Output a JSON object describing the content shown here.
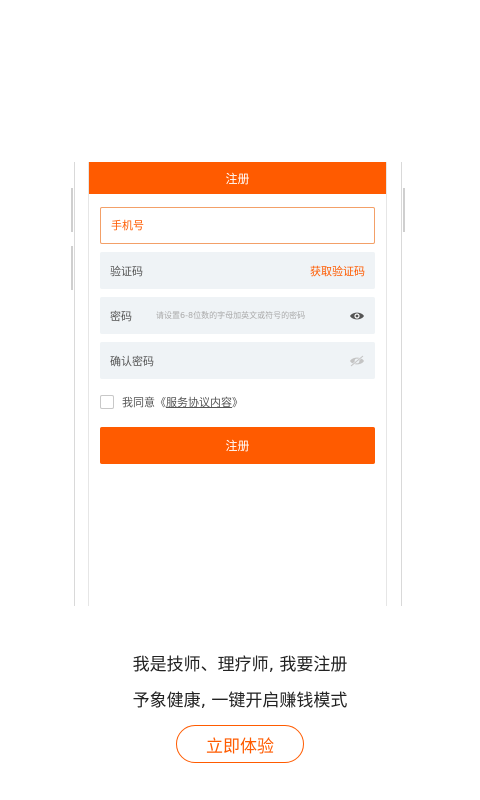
{
  "register_form": {
    "header_title": "注册",
    "phone_placeholder": "手机号",
    "code_label": "验证码",
    "get_code_label": "获取验证码",
    "password_label": "密码",
    "password_hint": "请设置6-8位数的字母加英文或符号的密码",
    "confirm_password_label": "确认密码",
    "agree_prefix": "我同意《",
    "agree_link": "服务协议内容",
    "agree_suffix": "》",
    "submit_label": "注册"
  },
  "promo": {
    "line1": "我是技师、理疗师, 我要注册",
    "line2": "予象健康, 一键开启赚钱模式",
    "try_button": "立即体验"
  },
  "icons": {
    "password_visibility": "eye-icon",
    "confirm_visibility": "eye-off-icon"
  },
  "colors": {
    "accent": "#ff5b00",
    "field_bg": "#eff3f6"
  }
}
